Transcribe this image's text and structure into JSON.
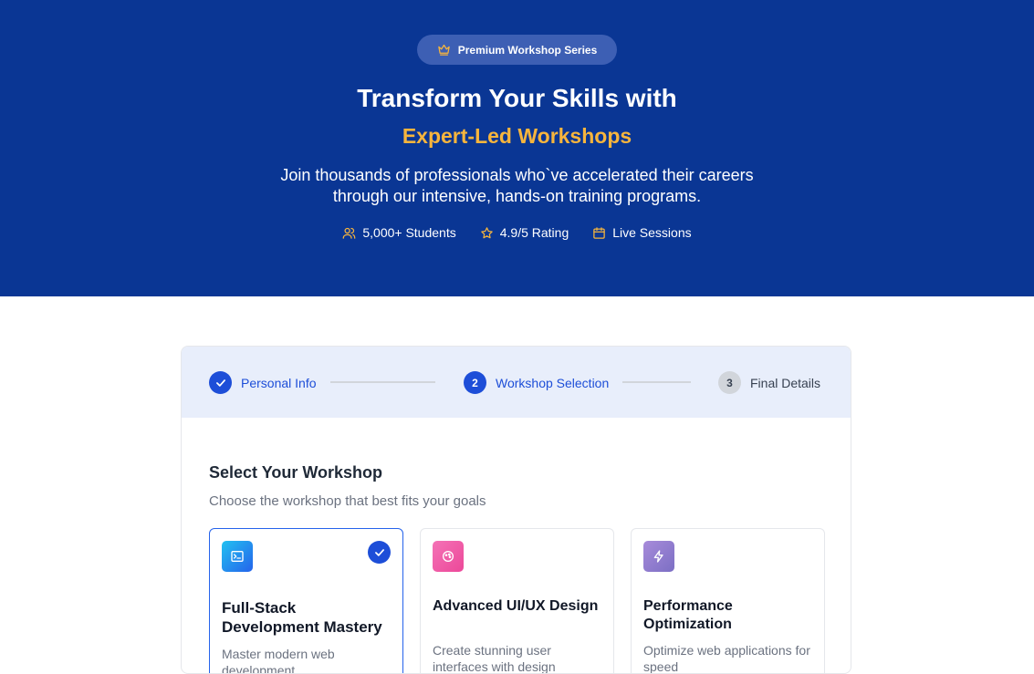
{
  "hero": {
    "badge": "Premium Workshop Series",
    "title": "Transform Your Skills with",
    "subtitle": "Expert-Led Workshops",
    "description": "Join thousands of professionals who`ve  accelerated their careers through our intensive, hands-on training programs.",
    "stats": [
      {
        "icon": "users-icon",
        "label": "5,000+ Students"
      },
      {
        "icon": "star-icon",
        "label": "4.9/5 Rating"
      },
      {
        "icon": "calendar-icon",
        "label": "Live Sessions"
      }
    ]
  },
  "stepper": {
    "steps": [
      {
        "label": "Personal Info",
        "state": "completed"
      },
      {
        "number": "2",
        "label": "Workshop Selection",
        "state": "active"
      },
      {
        "number": "3",
        "label": "Final Details",
        "state": "pending"
      }
    ]
  },
  "selection": {
    "title": "Select Your Workshop",
    "subtitle": "Choose the workshop that best fits your goals",
    "workshops": [
      {
        "icon": "terminal-icon",
        "title": "Full-Stack Development Mastery",
        "description": "Master modern web development",
        "selected": true
      },
      {
        "icon": "palette-icon",
        "title": "Advanced UI/UX Design",
        "description": "Create stunning user interfaces with design",
        "selected": false
      },
      {
        "icon": "lightning-icon",
        "title": "Performance Optimization",
        "description": "Optimize web applications for speed",
        "selected": false
      }
    ]
  },
  "colors": {
    "hero_bg": "#0a3694",
    "accent_gold": "#f7b53d",
    "primary_blue": "#1d4ed8",
    "stepper_bg": "#e8eefb"
  }
}
